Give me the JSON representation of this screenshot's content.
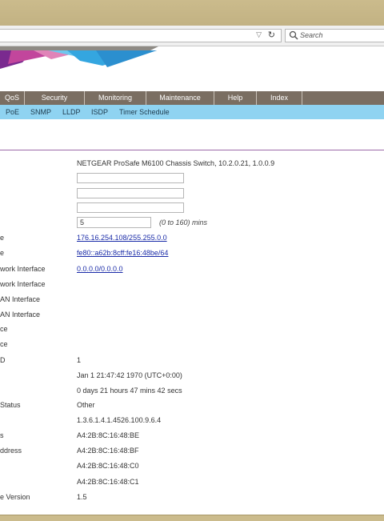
{
  "browser": {
    "search_placeholder": "Search"
  },
  "menu": [
    {
      "label": "QoS"
    },
    {
      "label": "Security"
    },
    {
      "label": "Monitoring"
    },
    {
      "label": "Maintenance"
    },
    {
      "label": "Help"
    },
    {
      "label": "Index"
    }
  ],
  "submenu": [
    {
      "label": "PoE"
    },
    {
      "label": "SNMP"
    },
    {
      "label": "LLDP"
    },
    {
      "label": "ISDP"
    },
    {
      "label": "Timer Schedule"
    }
  ],
  "info": {
    "system_description": "NETGEAR ProSafe M6100 Chassis Switch, 10.2.0.21, 1.0.0.9",
    "system_name": "",
    "system_location": "",
    "system_contact": "",
    "login_timeout": "5",
    "login_timeout_hint": "(0 to 160) mins",
    "service_port_ipv4_label": "e",
    "service_port_ipv4": "176.16.254.108/255.255.0.0",
    "service_port_ipv6_label": "e",
    "service_port_ipv6": "fe80::a62b:8cff:fe16:48be/64",
    "network_interface_ipv4_label": "work Interface",
    "network_interface_ipv4": "0.0.0.0/0.0.0.0",
    "network_interface_ipv6_label": "work Interface",
    "vlan_interface_ipv4_label": "AN Interface",
    "vlan_interface_ipv6_label": "AN Interface",
    "interface_a_label": "ce",
    "interface_b_label": "ce",
    "unit_label": "D",
    "unit_value": "1",
    "system_time": "Jan 1 21:47:42 1970 (UTC+0:00)",
    "up_time": "0 days 21 hours 47 mins 42 secs",
    "status_label": "Status",
    "status_value": "Other",
    "object_id": "1.3.6.1.4.1.4526.100.9.6.4",
    "mac1_label": "s",
    "mac1": "A4:2B:8C:16:48:BE",
    "mac2_label": "ddress",
    "mac2": "A4:2B:8C:16:48:BF",
    "mac3": "A4:2B:8C:16:48:C0",
    "mac4": "A4:2B:8C:16:48:C1",
    "version_label": "e Version",
    "version_value": "1.5"
  },
  "colors": {
    "menubar": "#7a6e62",
    "submenu": "#8fd3f1",
    "link": "#1b2ca8",
    "divider": "#9d6aa8"
  }
}
